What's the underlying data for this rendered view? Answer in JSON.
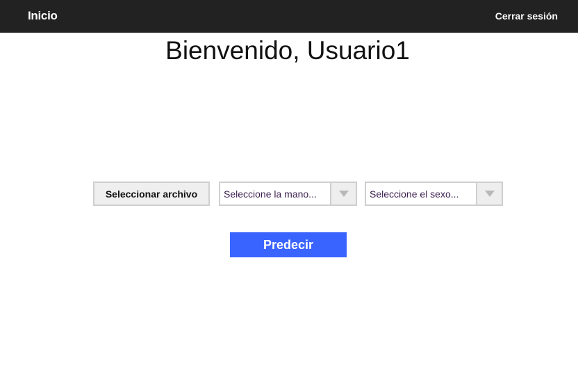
{
  "navbar": {
    "home_label": "Inicio",
    "logout_label": "Cerrar sesión"
  },
  "main": {
    "welcome": "Bienvenido, Usuario1"
  },
  "form": {
    "file_button_label": "Seleccionar archivo",
    "hand_select": {
      "selected": "Seleccione la mano...",
      "icon": "chevron-down-icon"
    },
    "sex_select": {
      "selected": "Seleccione el sexo...",
      "icon": "chevron-down-icon"
    },
    "predict_label": "Predecir"
  },
  "colors": {
    "navbar_bg": "#222222",
    "primary_button": "#3a64ff",
    "select_text": "#3a1f4d"
  }
}
